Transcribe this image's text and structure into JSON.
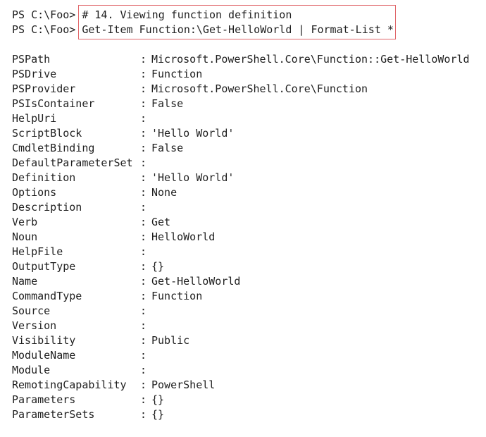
{
  "prompt": [
    {
      "prefix": "PS C:\\Foo> ",
      "command": "# 14. Viewing function definition"
    },
    {
      "prefix": "PS C:\\Foo> ",
      "command": "Get-Item Function:\\Get-HelloWorld | Format-List *"
    }
  ],
  "separator": ":",
  "properties": [
    {
      "name": "PSPath",
      "value": "Microsoft.PowerShell.Core\\Function::Get-HelloWorld"
    },
    {
      "name": "PSDrive",
      "value": "Function"
    },
    {
      "name": "PSProvider",
      "value": "Microsoft.PowerShell.Core\\Function"
    },
    {
      "name": "PSIsContainer",
      "value": "False"
    },
    {
      "name": "HelpUri",
      "value": ""
    },
    {
      "name": "ScriptBlock",
      "value": "'Hello World'"
    },
    {
      "name": "CmdletBinding",
      "value": "False"
    },
    {
      "name": "DefaultParameterSet",
      "value": ""
    },
    {
      "name": "Definition",
      "value": "'Hello World'"
    },
    {
      "name": "Options",
      "value": "None"
    },
    {
      "name": "Description",
      "value": ""
    },
    {
      "name": "Verb",
      "value": "Get"
    },
    {
      "name": "Noun",
      "value": "HelloWorld"
    },
    {
      "name": "HelpFile",
      "value": ""
    },
    {
      "name": "OutputType",
      "value": "{}"
    },
    {
      "name": "Name",
      "value": "Get-HelloWorld"
    },
    {
      "name": "CommandType",
      "value": "Function"
    },
    {
      "name": "Source",
      "value": ""
    },
    {
      "name": "Version",
      "value": ""
    },
    {
      "name": "Visibility",
      "value": "Public"
    },
    {
      "name": "ModuleName",
      "value": ""
    },
    {
      "name": "Module",
      "value": ""
    },
    {
      "name": "RemotingCapability",
      "value": "PowerShell"
    },
    {
      "name": "Parameters",
      "value": "{}"
    },
    {
      "name": "ParameterSets",
      "value": "{}"
    }
  ],
  "colors": {
    "highlight_border": "#e06468",
    "text": "#1f1f1f",
    "background": "#ffffff"
  }
}
